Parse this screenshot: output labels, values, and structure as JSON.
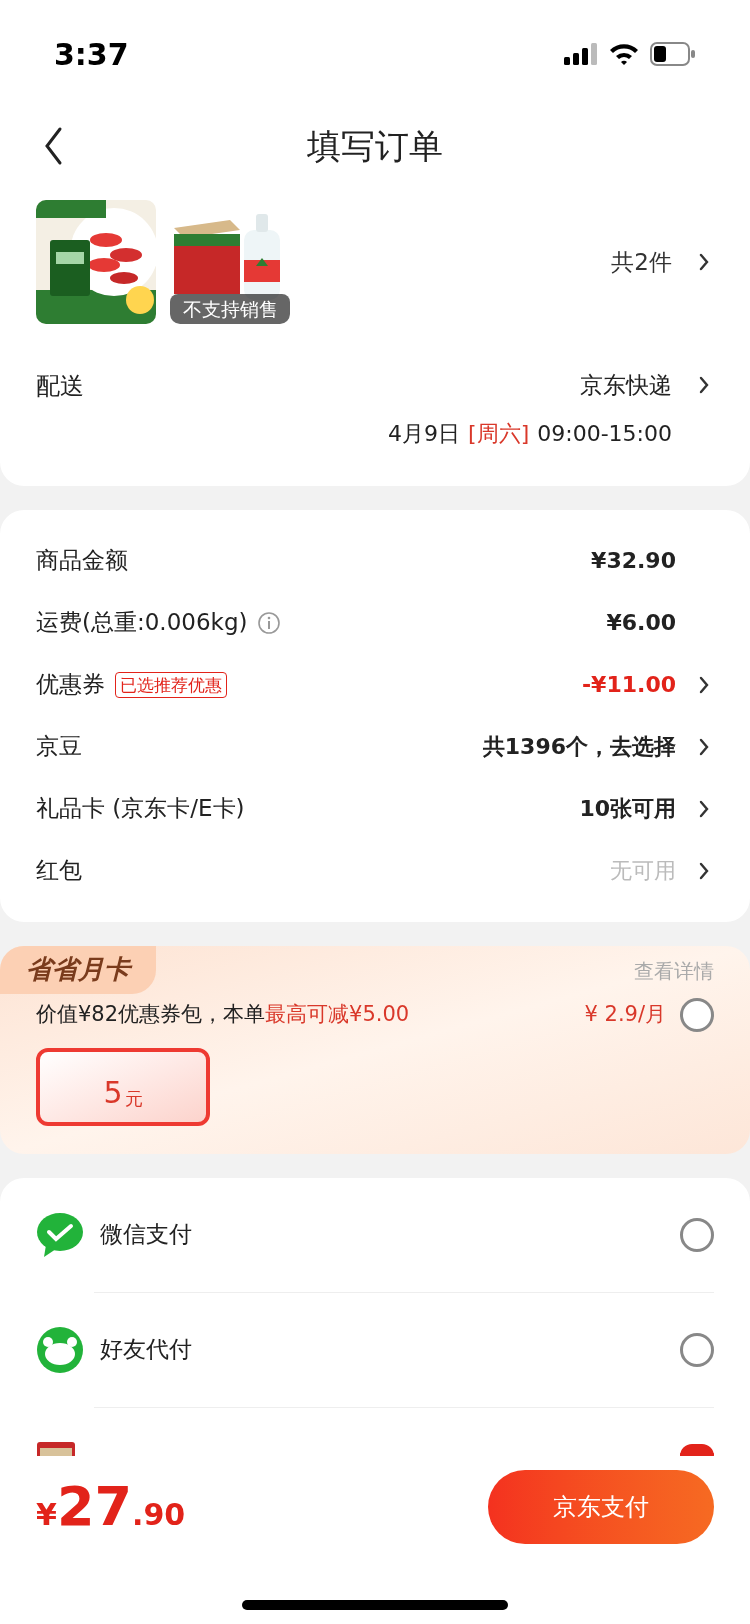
{
  "status_bar": {
    "time": "3:37"
  },
  "header": {
    "title": "填写订单"
  },
  "order": {
    "products": [
      {
        "kind": "picture"
      },
      {
        "kind": "picture",
        "tag": "不支持销售"
      }
    ],
    "count": "共2件",
    "delivery_label": "配送",
    "delivery_method": "京东快递",
    "date": "4月9日",
    "weekday": "[周六]",
    "time_slot": "09:00-15:00"
  },
  "fees": [
    {
      "label": "商品金额",
      "value": "¥32.90",
      "kind": "plain",
      "arrow": false
    },
    {
      "label": "运费(总重:0.006kg)",
      "value": "¥6.00",
      "kind": "info",
      "arrow": false
    },
    {
      "label": "优惠券",
      "badge": "已选推荐优惠",
      "value": "-¥11.00",
      "kind": "discount",
      "arrow": true
    },
    {
      "label": "京豆",
      "value": "共1396个，去选择",
      "kind": "plain",
      "arrow": true
    },
    {
      "label": "礼品卡 (京东卡/E卡)",
      "value": "10张可用",
      "kind": "plain",
      "arrow": true
    },
    {
      "label": "红包",
      "value": "无可用",
      "kind": "muted",
      "arrow": true
    }
  ],
  "monthly_card": {
    "title": "省省月卡",
    "details_link": "查看详情",
    "description": "价值¥82优惠券包，本单**最高可减¥5.00**",
    "price": "¥ 2.9/月",
    "selected": false,
    "coupon_amount": "5",
    "coupon_unit": "元"
  },
  "payment_methods": [
    {
      "label": "微信支付",
      "kind": "wechat",
      "selected": false
    },
    {
      "label": "好友代付",
      "kind": "friend",
      "selected": false
    },
    {
      "kind": "card",
      "selected": true
    }
  ],
  "footer": {
    "currency": "¥",
    "amount": "27",
    "decimals": ".90",
    "pay_button": "京东支付"
  }
}
